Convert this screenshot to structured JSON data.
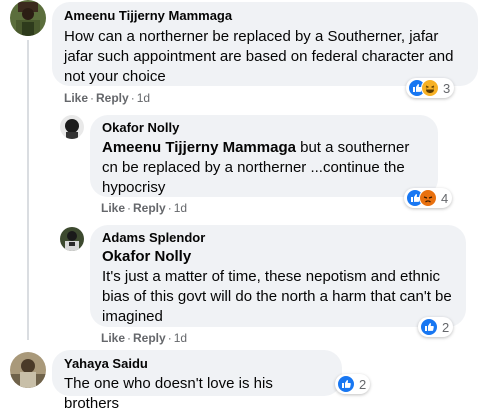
{
  "comments": [
    {
      "author": "Ameenu Tijjerny Mammaga",
      "mention": "",
      "text": "How can a northerner be replaced by a Southerner, jafar jafar such appointment are based on federal character and not your choice",
      "like": "Like",
      "reply": "Reply",
      "time": "1d",
      "reaction_count": "3",
      "reactions": [
        "like-icon",
        "haha-icon"
      ]
    },
    {
      "author": "Okafor Nolly",
      "mention": "Ameenu Tijjerny Mammaga",
      "text": " but a southerner cn be replaced by a northerner ...continue the hypocrisy",
      "like": "Like",
      "reply": "Reply",
      "time": "1d",
      "reaction_count": "4",
      "reactions": [
        "like-icon",
        "angry-icon"
      ]
    },
    {
      "author": "Adams Splendor",
      "mention": "Okafor Nolly",
      "text": "It's just a matter of time, these nepotism and ethnic bias of this govt will do the north a harm that can't be imagined",
      "like": "Like",
      "reply": "Reply",
      "time": "1d",
      "reaction_count": "2",
      "reactions": [
        "like-icon"
      ]
    },
    {
      "author": "Yahaya Saidu",
      "mention": "",
      "text": "The one who doesn't love is his brothers",
      "reaction_count": "2",
      "reactions": [
        "like-icon"
      ]
    }
  ],
  "colors": {
    "like": "#1877f2",
    "bubble": "#f0f2f5",
    "meta": "#65676b"
  }
}
